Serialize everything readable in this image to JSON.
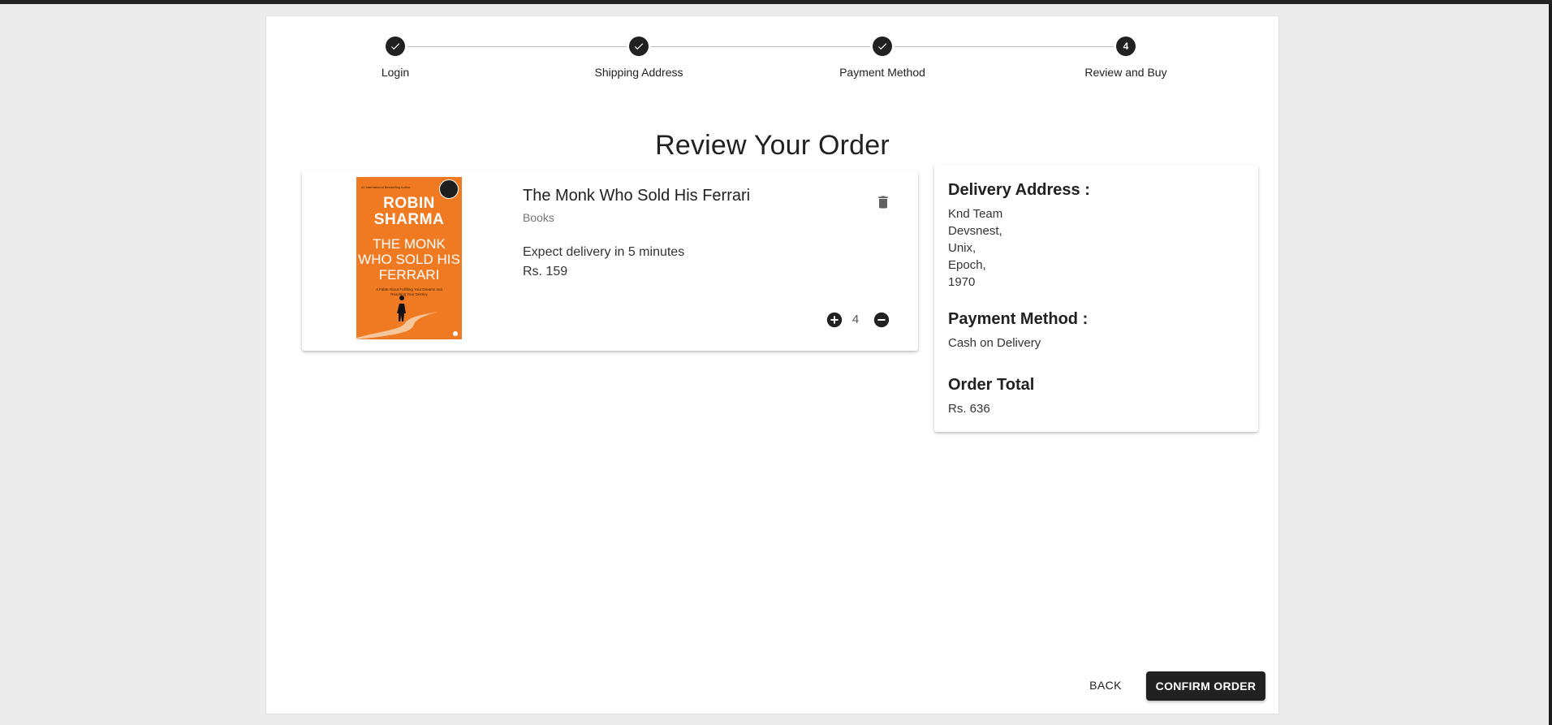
{
  "stepper": {
    "steps": [
      {
        "label": "Login",
        "status": "completed",
        "icon": "check-icon"
      },
      {
        "label": "Shipping Address",
        "status": "completed",
        "icon": "check-icon"
      },
      {
        "label": "Payment Method",
        "status": "completed",
        "icon": "check-icon"
      },
      {
        "label": "Review and Buy",
        "status": "active",
        "number": "4"
      }
    ]
  },
  "page": {
    "title": "Review Your Order"
  },
  "product": {
    "name": "The Monk Who Sold His Ferrari",
    "category": "Books",
    "delivery": "Expect delivery in 5 minutes",
    "price": "Rs. 159",
    "quantity": "4",
    "cover": {
      "tagline": "#1 International Bestselling Author",
      "author": "ROBIN SHARMA",
      "title": "THE MONK WHO SOLD HIS FERRARI",
      "subtitle": "A Fable About Fulfilling Your Dreams and Reaching Your Destiny",
      "color": "#f07a22"
    }
  },
  "summary": {
    "address_heading": "Delivery Address :",
    "address_lines": [
      "Knd Team",
      "Devsnest,",
      "Unix,",
      "Epoch,",
      "1970"
    ],
    "payment_heading": "Payment Method :",
    "payment_value": "Cash on Delivery",
    "total_heading": "Order Total",
    "total_value": "Rs. 636"
  },
  "actions": {
    "back_label": "BACK",
    "confirm_label": "CONFIRM ORDER"
  },
  "colors": {
    "accent": "#212121",
    "background": "#ebebeb",
    "panel": "#ffffff"
  }
}
